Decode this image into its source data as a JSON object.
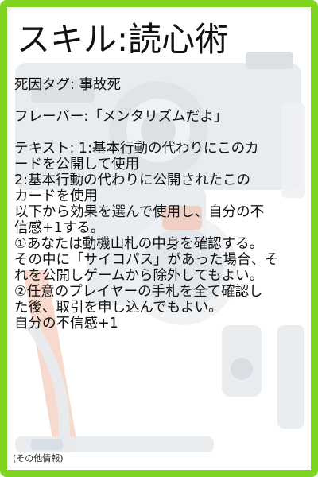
{
  "card": {
    "title": "スキル:読心術",
    "death_tag": "死因タグ: 事故死",
    "flavor": "フレーバー:「メンタリズムだよ」",
    "text_lines": [
      "テキスト: 1:基本行動の代わりにこのカ",
      "ードを公開して使用",
      "2:基本行動の代わりに公開されたこの",
      "カードを使用",
      "以下から効果を選んで使用し、自分の不",
      "信感+1する。",
      "①あなたは動機山札の中身を確認する。",
      "その中に「サイコパス」があった場合、そ",
      "れを公開しゲームから除外してもよい。",
      "②任意のプレイヤーの手札を全て確認し",
      "た後、取引を申し込んでもよい。",
      "自分の不信感+1"
    ],
    "footer": "(その他情報)"
  },
  "colors": {
    "border": "#7fd321",
    "background_art": "#e7ebee",
    "background_art_dark": "#d7dde2",
    "accent": "#f3b9a6"
  },
  "icons": {
    "background": "desk-items-illustration"
  }
}
